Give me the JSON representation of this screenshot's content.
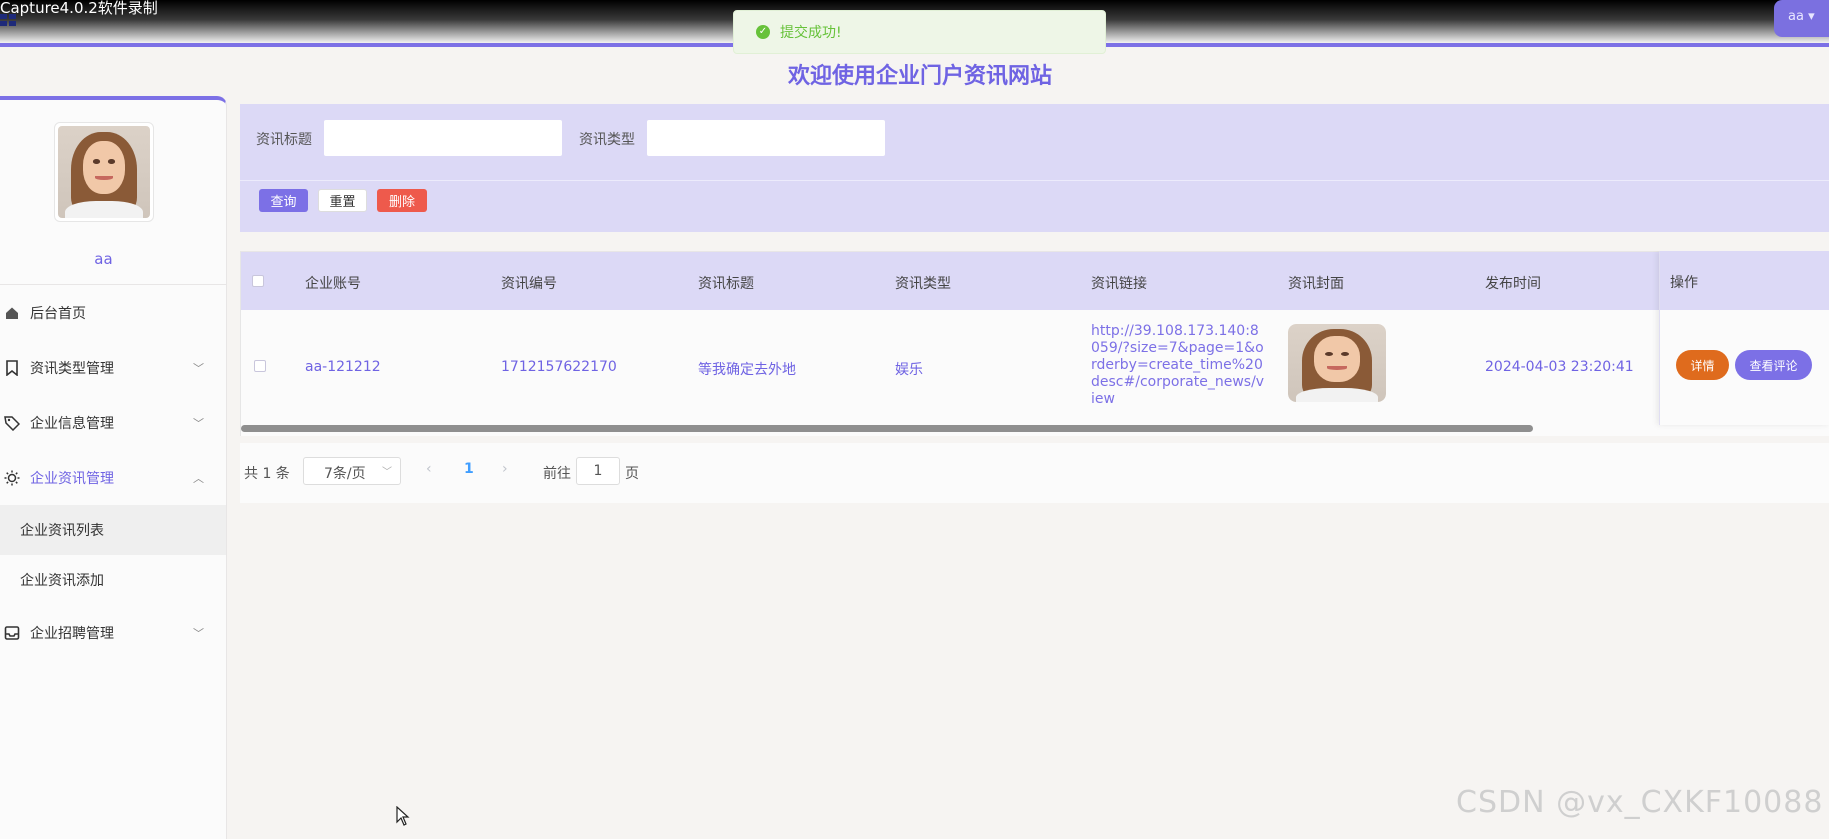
{
  "capture": {
    "title": "Capture4.0.2软件录制"
  },
  "header": {
    "user_menu": "aa ▾"
  },
  "toast": {
    "message": "提交成功!"
  },
  "page_title": "欢迎使用企业门户资讯网站",
  "sidebar": {
    "username": "aa",
    "items": [
      {
        "label": "后台首页",
        "icon": "home-icon"
      },
      {
        "label": "资讯类型管理",
        "icon": "bookmark-icon"
      },
      {
        "label": "企业信息管理",
        "icon": "tag-icon"
      },
      {
        "label": "企业资讯管理",
        "icon": "sun-icon"
      },
      {
        "label": "企业招聘管理",
        "icon": "inbox-icon"
      }
    ],
    "subitems": [
      {
        "label": "企业资讯列表"
      },
      {
        "label": "企业资讯添加"
      }
    ]
  },
  "search": {
    "title_label": "资讯标题",
    "title_value": "",
    "type_label": "资讯类型",
    "type_value": "",
    "query_button": "查询",
    "reset_button": "重置",
    "delete_button": "删除"
  },
  "table": {
    "columns": [
      "企业账号",
      "资讯编号",
      "资讯标题",
      "资讯类型",
      "资讯链接",
      "资讯封面",
      "发布时间",
      "操作"
    ],
    "rows": [
      {
        "account": "aa-121212",
        "number": "1712157622170",
        "title": "等我确定去外地",
        "type": "娱乐",
        "link": "http://39.108.173.140:8059/?size=7&page=1&orderby=create_time%20desc#/corporate_news/view",
        "published": "2024-04-03 23:20:41",
        "detail_button": "详情",
        "comment_button": "查看评论"
      }
    ]
  },
  "pagination": {
    "total_text": "共 1 条",
    "page_size": "7条/页",
    "current_page": "1",
    "goto_label": "前往",
    "goto_value": "1",
    "page_suffix": "页"
  },
  "watermark": "CSDN @vx_CXKF10088",
  "colors": {
    "accent": "#7c70e6",
    "panel": "#dcd9f6",
    "danger": "#ee5a4c",
    "warning": "#df6b1d",
    "success": "#67c23a"
  }
}
